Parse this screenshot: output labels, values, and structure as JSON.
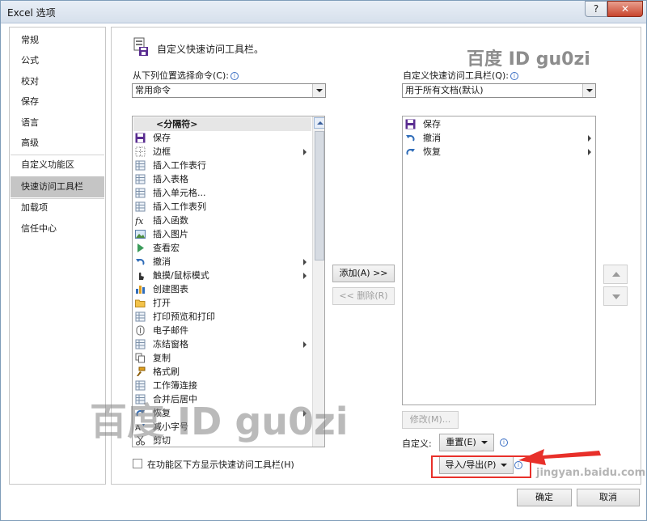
{
  "window": {
    "title": "Excel 选项",
    "help_label": "?",
    "close_label": "✕"
  },
  "nav": {
    "items": [
      {
        "label": "常规",
        "selected": false
      },
      {
        "label": "公式",
        "selected": false
      },
      {
        "label": "校对",
        "selected": false
      },
      {
        "label": "保存",
        "selected": false
      },
      {
        "label": "语言",
        "selected": false
      },
      {
        "label": "高级",
        "selected": false
      },
      {
        "label": "自定义功能区",
        "selected": false
      },
      {
        "label": "快速访问工具栏",
        "selected": true
      },
      {
        "label": "加载项",
        "selected": false
      },
      {
        "label": "信任中心",
        "selected": false
      }
    ]
  },
  "main": {
    "heading": "自定义快速访问工具栏。",
    "left": {
      "choose_label": "从下列位置选择命令(C):",
      "choose_value": "常用命令",
      "commands": [
        {
          "label": "<分隔符>",
          "icon": "separator-icon",
          "separator": true,
          "submenu": false
        },
        {
          "label": "保存",
          "icon": "save-icon",
          "submenu": false
        },
        {
          "label": "边框",
          "icon": "border-icon",
          "submenu": true
        },
        {
          "label": "插入工作表行",
          "icon": "insert-row-icon",
          "submenu": false
        },
        {
          "label": "插入表格",
          "icon": "insert-table-icon",
          "submenu": false
        },
        {
          "label": "插入单元格...",
          "icon": "insert-cells-icon",
          "submenu": false
        },
        {
          "label": "插入工作表列",
          "icon": "insert-column-icon",
          "submenu": false
        },
        {
          "label": "插入函数",
          "icon": "function-icon",
          "submenu": false
        },
        {
          "label": "插入图片",
          "icon": "picture-icon",
          "submenu": false
        },
        {
          "label": "查看宏",
          "icon": "macro-icon",
          "submenu": false
        },
        {
          "label": "撤消",
          "icon": "undo-icon",
          "submenu": true
        },
        {
          "label": "触摸/鼠标模式",
          "icon": "touch-mode-icon",
          "submenu": true
        },
        {
          "label": "创建图表",
          "icon": "chart-icon",
          "submenu": false
        },
        {
          "label": "打开",
          "icon": "open-folder-icon",
          "submenu": false
        },
        {
          "label": "打印预览和打印",
          "icon": "print-preview-icon",
          "submenu": false
        },
        {
          "label": "电子邮件",
          "icon": "email-icon",
          "submenu": false
        },
        {
          "label": "冻结窗格",
          "icon": "freeze-panes-icon",
          "submenu": true
        },
        {
          "label": "复制",
          "icon": "copy-icon",
          "submenu": false
        },
        {
          "label": "格式刷",
          "icon": "format-painter-icon",
          "submenu": false
        },
        {
          "label": "工作簿连接",
          "icon": "connections-icon",
          "submenu": false
        },
        {
          "label": "合并后居中",
          "icon": "merge-center-icon",
          "submenu": false
        },
        {
          "label": "恢复",
          "icon": "redo-icon",
          "submenu": true
        },
        {
          "label": "减小字号",
          "icon": "decrease-font-icon",
          "submenu": false
        },
        {
          "label": "剪切",
          "icon": "cut-icon",
          "submenu": false
        }
      ]
    },
    "middle": {
      "add_label": "添加(A) >>",
      "remove_label": "<< 删除(R)"
    },
    "right": {
      "customize_label": "自定义快速访问工具栏(Q):",
      "customize_value": "用于所有文档(默认)",
      "items": [
        {
          "label": "保存",
          "icon": "save-icon",
          "submenu": false
        },
        {
          "label": "撤消",
          "icon": "undo-icon",
          "submenu": true
        },
        {
          "label": "恢复",
          "icon": "redo-icon",
          "submenu": true
        }
      ],
      "modify_label": "修改(M)...",
      "custom_label": "自定义:",
      "reset_label": "重置(E)",
      "import_export_label": "导入/导出(P)"
    },
    "show_below_label": "在功能区下方显示快速访问工具栏(H)"
  },
  "footer": {
    "ok_label": "确定",
    "cancel_label": "取消"
  },
  "watermarks": {
    "top": "百度 ID gu0zi",
    "center": "百度 ID gu0zi",
    "corner": "jingyan.baidu.com"
  },
  "colors": {
    "highlight": "#e8302a",
    "nav_selected": "#c5c5c5"
  }
}
